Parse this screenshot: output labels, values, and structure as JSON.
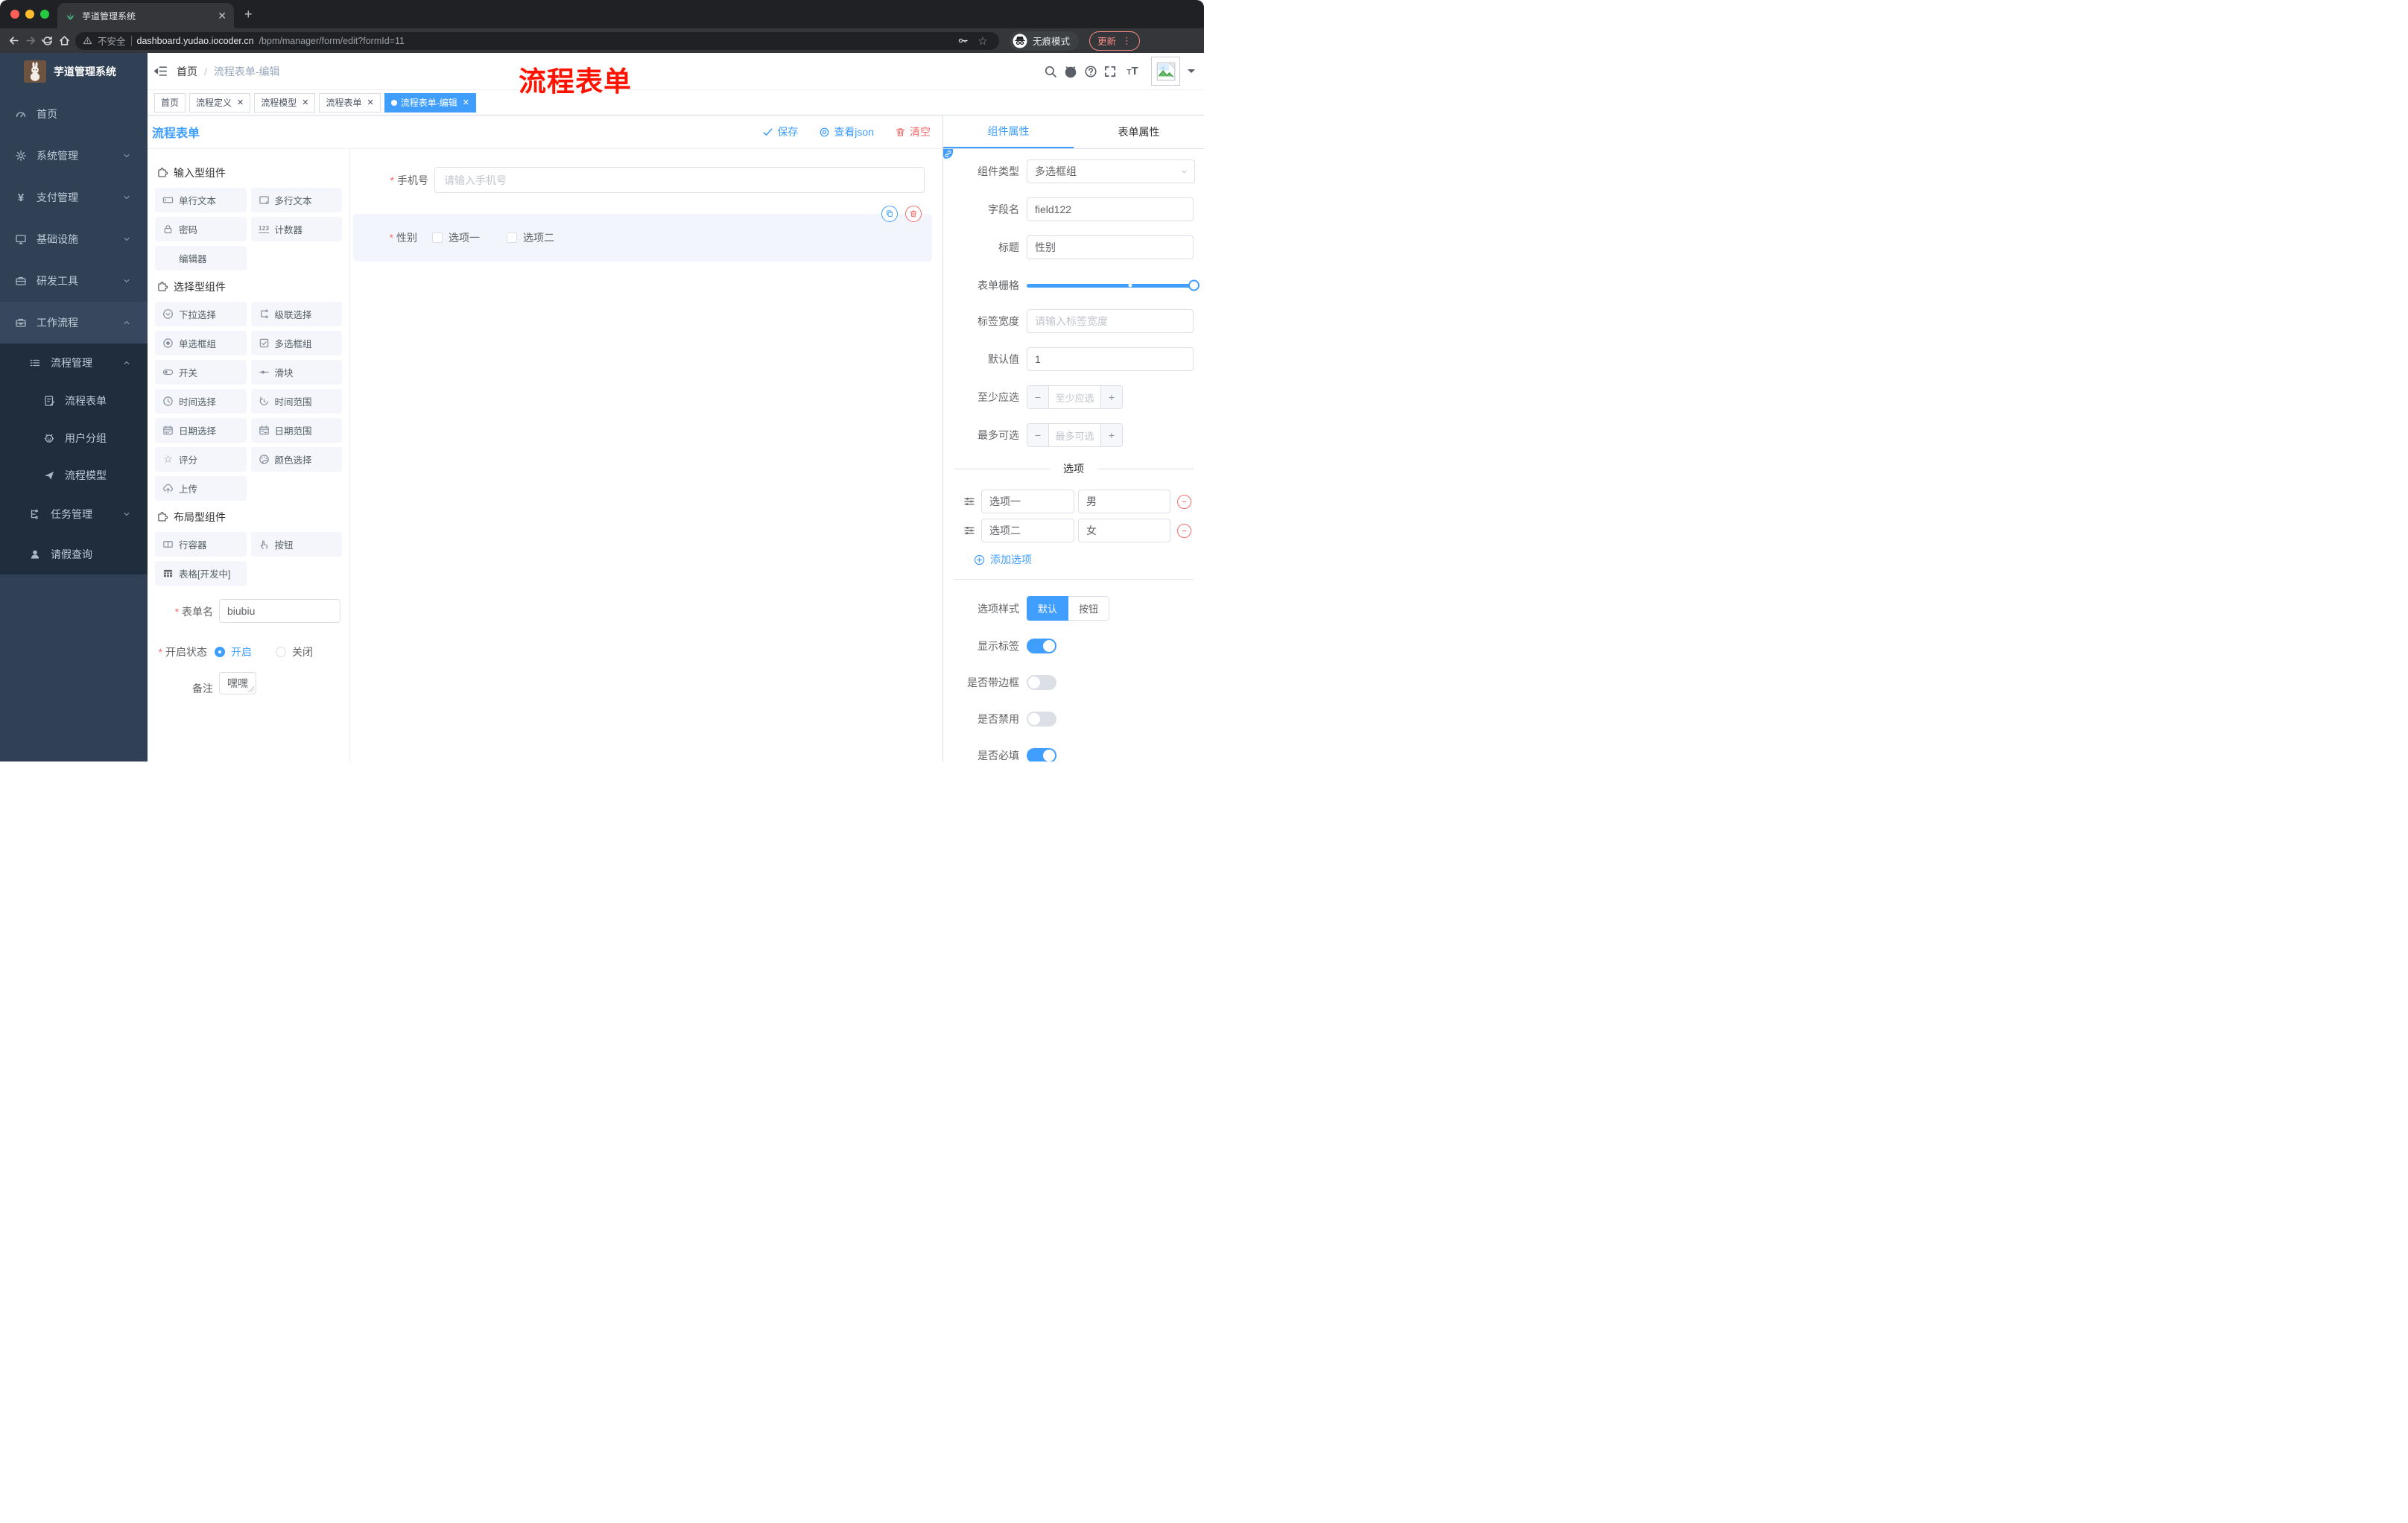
{
  "colors": {
    "primary": "#409eff",
    "danger": "#f56c6c",
    "sidebar_bg": "#304156",
    "submenu_bg": "#1f2d3d"
  },
  "browser": {
    "tab_title": "芋道管理系统",
    "security_label": "不安全",
    "url_host": "dashboard.yudao.iocoder.cn",
    "url_path": "/bpm/manager/form/edit?formId=11",
    "incognito_label": "无痕模式",
    "update_label": "更新"
  },
  "sidebar": {
    "logo_title": "芋道管理系统",
    "items": [
      {
        "label": "首页",
        "icon": "dashboard-icon",
        "level": 1,
        "chevron": "",
        "zone": "root"
      },
      {
        "label": "系统管理",
        "icon": "gear-icon",
        "level": 1,
        "chevron": "down",
        "zone": "root"
      },
      {
        "label": "支付管理",
        "icon": "yen-icon",
        "level": 1,
        "chevron": "down",
        "zone": "root"
      },
      {
        "label": "基础设施",
        "icon": "monitor-icon",
        "level": 1,
        "chevron": "down",
        "zone": "root"
      },
      {
        "label": "研发工具",
        "icon": "toolbox-icon",
        "level": 1,
        "chevron": "down",
        "zone": "root"
      },
      {
        "label": "工作流程",
        "icon": "briefcase-icon",
        "level": 1,
        "chevron": "up",
        "zone": "root",
        "highlight": true
      },
      {
        "label": "流程管理",
        "icon": "flow-list-icon",
        "level": 2,
        "chevron": "up",
        "zone": "sub",
        "h": 52
      },
      {
        "label": "流程表单",
        "icon": "form-doc-icon",
        "level": 3,
        "chevron": "",
        "zone": "sub",
        "h": 50
      },
      {
        "label": "用户分组",
        "icon": "robot-face-icon",
        "level": 3,
        "chevron": "",
        "zone": "sub",
        "h": 50
      },
      {
        "label": "流程模型",
        "icon": "paper-plane-icon",
        "level": 3,
        "chevron": "",
        "zone": "sub",
        "h": 50
      },
      {
        "label": "任务管理",
        "icon": "org-tree-icon",
        "level": 2,
        "chevron": "down",
        "zone": "sub",
        "h": 54
      },
      {
        "label": "请假查询",
        "icon": "user-icon",
        "level": 2,
        "chevron": "",
        "zone": "sub",
        "h": 54
      }
    ]
  },
  "header": {
    "breadcrumb": [
      "首页",
      "流程表单-编辑"
    ],
    "annotation": "流程表单"
  },
  "tags": [
    {
      "label": "首页",
      "closable": false,
      "active": false
    },
    {
      "label": "流程定义",
      "closable": true,
      "active": false
    },
    {
      "label": "流程模型",
      "closable": true,
      "active": false
    },
    {
      "label": "流程表单",
      "closable": true,
      "active": false
    },
    {
      "label": "流程表单-编辑",
      "closable": true,
      "active": true
    }
  ],
  "toolbar": {
    "title": "流程表单",
    "save_label": "保存",
    "view_json_label": "查看json",
    "clear_label": "清空"
  },
  "components_panel": {
    "sections": [
      {
        "title": "输入型组件",
        "items": [
          {
            "label": "单行文本",
            "icon": "input-icon"
          },
          {
            "label": "多行文本",
            "icon": "textarea-icon"
          },
          {
            "label": "密码",
            "icon": "password-icon"
          },
          {
            "label": "计数器",
            "icon": "counter-icon"
          },
          {
            "label": "编辑器",
            "icon": ""
          }
        ]
      },
      {
        "title": "选择型组件",
        "items": [
          {
            "label": "下拉选择",
            "icon": "select-icon"
          },
          {
            "label": "级联选择",
            "icon": "cascader-icon"
          },
          {
            "label": "单选框组",
            "icon": "radio-icon"
          },
          {
            "label": "多选框组",
            "icon": "checkbox-icon"
          },
          {
            "label": "开关",
            "icon": "switch-icon"
          },
          {
            "label": "滑块",
            "icon": "slider-icon"
          },
          {
            "label": "时间选择",
            "icon": "time-icon"
          },
          {
            "label": "时间范围",
            "icon": "time-range-icon"
          },
          {
            "label": "日期选择",
            "icon": "date-icon"
          },
          {
            "label": "日期范围",
            "icon": "date-range-icon"
          },
          {
            "label": "评分",
            "icon": "star-icon"
          },
          {
            "label": "颜色选择",
            "icon": "color-icon"
          },
          {
            "label": "上传",
            "icon": "upload-icon"
          }
        ]
      },
      {
        "title": "布局型组件",
        "items": [
          {
            "label": "行容器",
            "icon": "row-icon"
          },
          {
            "label": "按钮",
            "icon": "button-hand-icon"
          },
          {
            "label": "表格[开发中]",
            "icon": "table-icon"
          }
        ]
      }
    ],
    "form": {
      "name_label": "表单名",
      "name_value": "biubiu",
      "status_label": "开启状态",
      "status_on": "开启",
      "status_off": "关闭",
      "remark_label": "备注",
      "remark_value": "嘿嘿"
    }
  },
  "canvas": {
    "phone": {
      "label": "手机号",
      "placeholder": "请输入手机号"
    },
    "gender": {
      "label": "性别",
      "options": [
        "选项一",
        "选项二"
      ]
    }
  },
  "properties_panel": {
    "tabs": [
      "组件属性",
      "表单属性"
    ],
    "fields": {
      "component_type_label": "组件类型",
      "component_type_value": "多选框组",
      "field_name_label": "字段名",
      "field_name_value": "field122",
      "title_label": "标题",
      "title_value": "性别",
      "grid_label": "表单栅格",
      "label_width_label": "标签宽度",
      "label_width_placeholder": "请输入标签宽度",
      "default_label": "默认值",
      "default_value": "1",
      "min_label": "至少应选",
      "min_placeholder": "至少应选",
      "max_label": "最多可选",
      "max_placeholder": "最多可选"
    },
    "options_section": {
      "title": "选项",
      "rows": [
        {
          "label": "选项一",
          "value": "男"
        },
        {
          "label": "选项二",
          "value": "女"
        }
      ],
      "add_label": "添加选项"
    },
    "style": {
      "option_style_label": "选项样式",
      "style_options": [
        "默认",
        "按钮"
      ],
      "active_style": 0,
      "toggles": [
        {
          "label": "显示标签",
          "on": true
        },
        {
          "label": "是否带边框",
          "on": false
        },
        {
          "label": "是否禁用",
          "on": false
        },
        {
          "label": "是否必填",
          "on": true
        }
      ]
    }
  }
}
